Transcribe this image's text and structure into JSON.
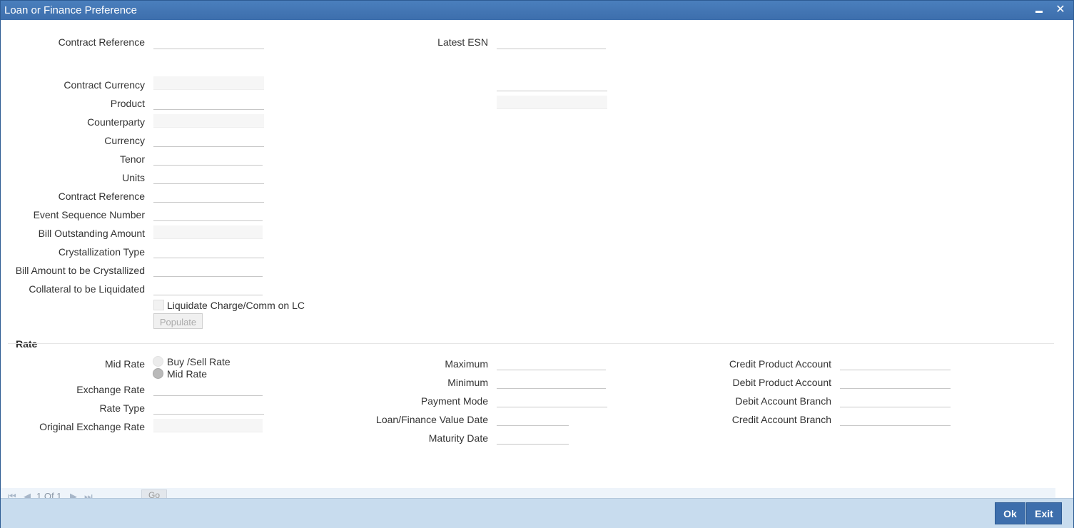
{
  "window": {
    "title": "Loan or Finance Preference"
  },
  "header": {
    "contract_reference_label": "Contract Reference",
    "latest_esn_label": "Latest ESN"
  },
  "fields": {
    "contract_currency": "Contract Currency",
    "product": "Product",
    "counterparty": "Counterparty",
    "currency": "Currency",
    "tenor": "Tenor",
    "units": "Units",
    "contract_reference": "Contract Reference",
    "event_sequence_number": "Event Sequence Number",
    "bill_outstanding_amount": "Bill Outstanding Amount",
    "crystallization_type": "Crystallization Type",
    "bill_amount_to_be_crystallized": "Bill Amount to be Crystallized",
    "collateral_to_be_liquidated": "Collateral to be Liquidated"
  },
  "liquidate_checkbox_label": "Liquidate Charge/Comm on LC",
  "populate_button": "Populate",
  "rate": {
    "section_title": "Rate",
    "mid_rate_label": "Mid Rate",
    "radio_buy_sell": "Buy /Sell Rate",
    "radio_mid": "Mid Rate",
    "selected": "Mid Rate",
    "exchange_rate": "Exchange Rate",
    "rate_type": "Rate Type",
    "original_exchange_rate": "Original Exchange Rate",
    "maximum": "Maximum",
    "minimum": "Minimum",
    "payment_mode": "Payment Mode",
    "loan_finance_value_date": "Loan/Finance Value Date",
    "maturity_date": "Maturity Date",
    "credit_product_account": "Credit Product Account",
    "debit_product_account": "Debit Product Account",
    "debit_account_branch": "Debit Account Branch",
    "credit_account_branch": "Credit Account Branch"
  },
  "pager": {
    "text": "1 Of 1",
    "go": "Go"
  },
  "footer": {
    "ok": "Ok",
    "exit": "Exit"
  }
}
